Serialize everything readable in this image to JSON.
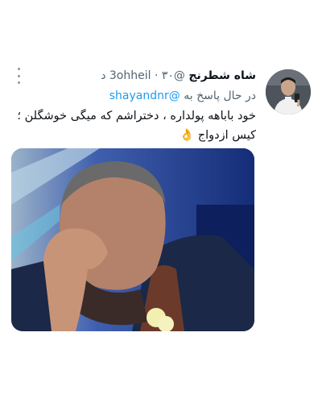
{
  "tweet": {
    "author_name": "شاه شطرنج",
    "author_handle": "@3ohheil",
    "time": "۳۰ د",
    "reply_prefix": "در حال پاسخ به",
    "reply_to": "@shayandnr",
    "text_line1": "خود باباهه پولداره ، دختراشم که میگی خوشگلن ؛",
    "text_line2": "کیس ازدواج",
    "emoji": "👌"
  },
  "colors": {
    "mention": "#1d9bf0",
    "secondary_text": "#536471",
    "primary_text": "#0f1419"
  }
}
